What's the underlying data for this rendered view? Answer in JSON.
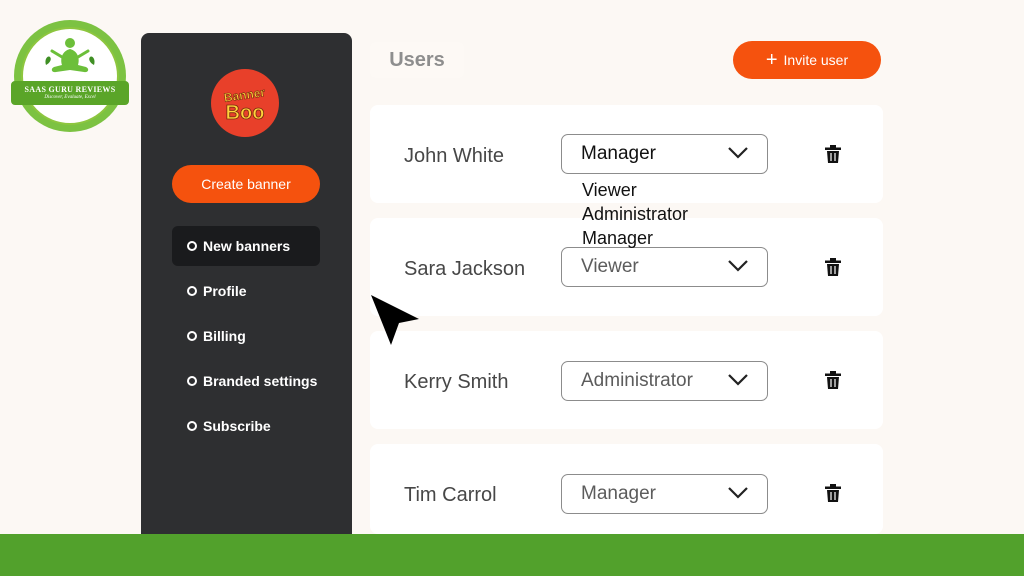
{
  "watermark": {
    "title": "SAAS GURU REVIEWS",
    "tagline": "Discover, Evaluate, Excel"
  },
  "sidebar": {
    "logo_text": "BANNER BOO",
    "create_button": "Create banner",
    "items": [
      {
        "label": "New banners",
        "active": true
      },
      {
        "label": "Profile",
        "active": false
      },
      {
        "label": "Billing",
        "active": false
      },
      {
        "label": "Branded settings",
        "active": false
      },
      {
        "label": "Subscribe",
        "active": false
      }
    ]
  },
  "header": {
    "title": "Users",
    "invite_button": "Invite user"
  },
  "users": [
    {
      "name": "John White",
      "role": "Manager"
    },
    {
      "name": "Sara Jackson",
      "role": "Viewer"
    },
    {
      "name": "Kerry Smith",
      "role": "Administrator"
    },
    {
      "name": "Tim Carrol",
      "role": "Manager"
    }
  ],
  "role_dropdown": {
    "options": [
      "Viewer",
      "Administrator",
      "Manager"
    ]
  },
  "colors": {
    "accent": "#f5520e",
    "sidebar_bg": "#2e2f31",
    "footer_green": "#52a12c",
    "page_bg": "#fcf8f4"
  }
}
